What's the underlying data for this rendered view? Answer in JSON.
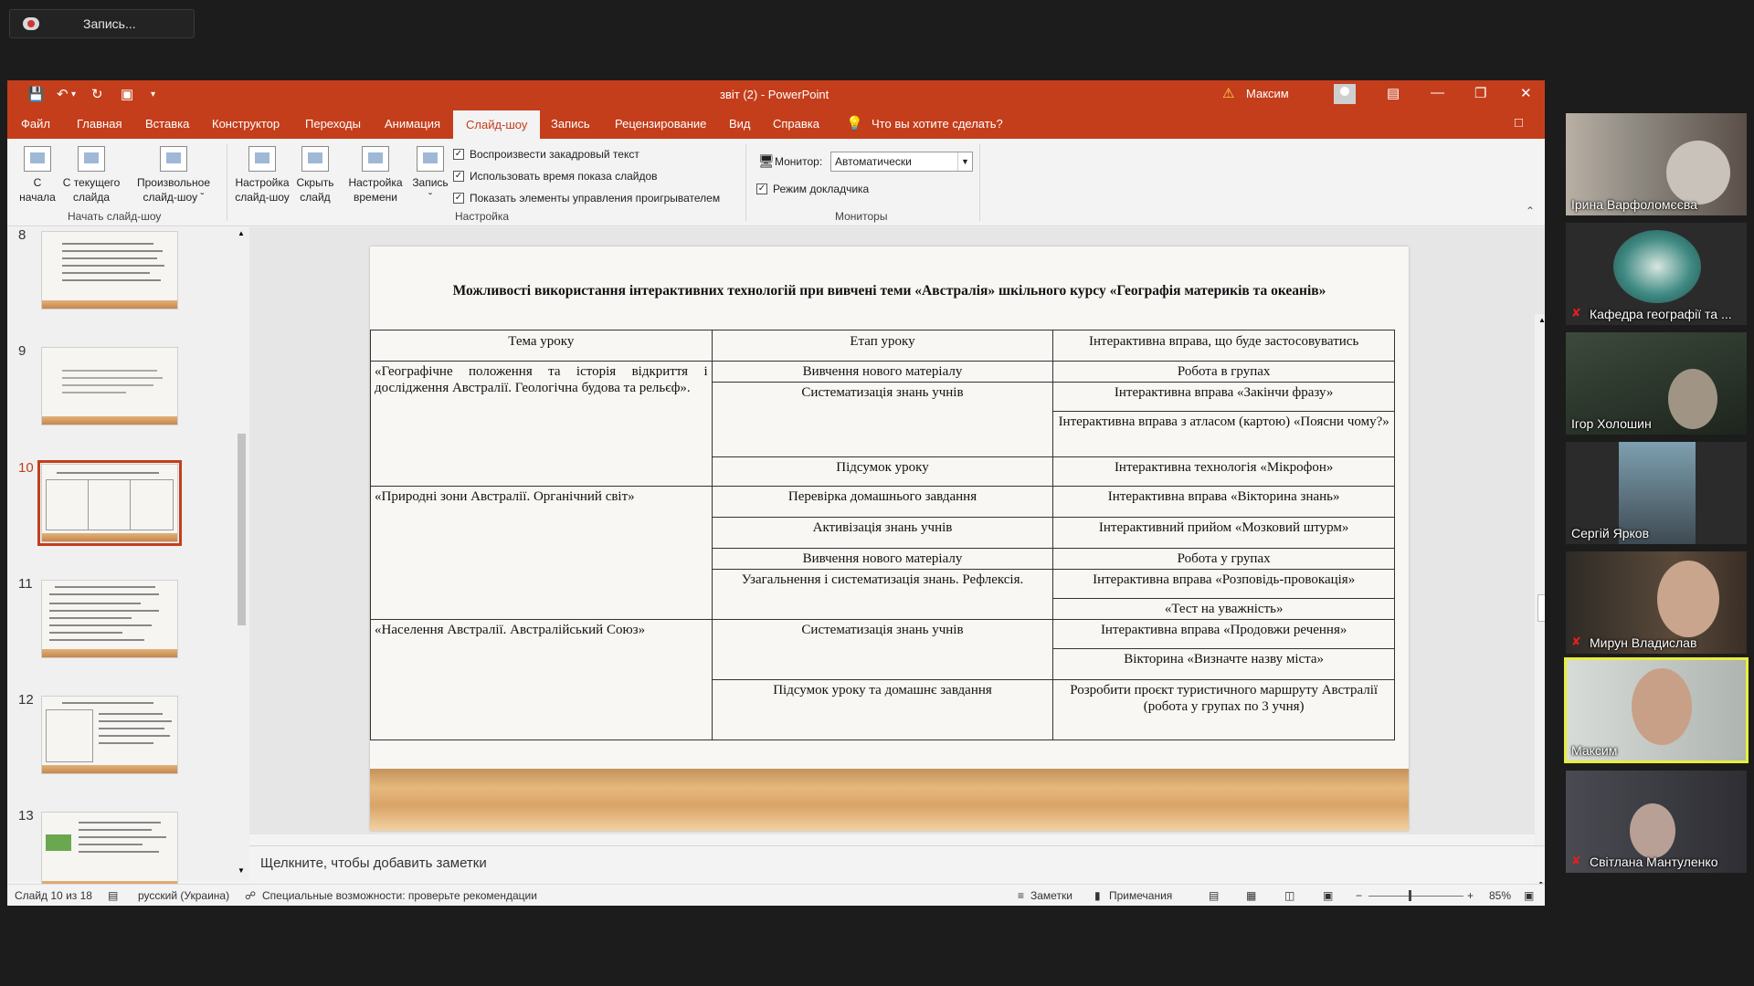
{
  "recording": {
    "label": "Запись..."
  },
  "window": {
    "title": "звіт (2)  -  PowerPoint",
    "user": "Максим"
  },
  "menu": {
    "tabs": [
      "Файл",
      "Главная",
      "Вставка",
      "Конструктор",
      "Переходы",
      "Анимация",
      "Слайд-шоу",
      "Запись",
      "Рецензирование",
      "Вид",
      "Справка"
    ],
    "active_tab": "Слайд-шоу",
    "search": "Что вы хотите сделать?"
  },
  "ribbon": {
    "from_start": "С начала",
    "from_current": [
      "С текущего",
      "слайда"
    ],
    "custom_show": [
      "Произвольное",
      "слайд-шоу"
    ],
    "group_start": "Начать слайд-шоу",
    "setup_show": [
      "Настройка",
      "слайд-шоу"
    ],
    "hide_slide": [
      "Скрыть",
      "слайд"
    ],
    "rehearse": [
      "Настройка",
      "времени"
    ],
    "record": "Запись",
    "check_narration": "Воспроизвести закадровый текст",
    "check_timings": "Использовать время показа слайдов",
    "check_media": "Показать элементы управления проигрывателем",
    "group_setup": "Настройка",
    "monitor_label": "Монитор:",
    "monitor_value": "Автоматически",
    "presenter_view": "Режим докладчика",
    "group_monitors": "Мониторы"
  },
  "thumbnails": {
    "numbers": [
      "8",
      "9",
      "10",
      "11",
      "12",
      "13"
    ],
    "active": "10"
  },
  "slide": {
    "title": "Можливості використання інтерактивних технологій при вивчені теми «Австралія» шкільного курсу «Географія материків та океанів»",
    "headers": [
      "Тема уроку",
      "Етап уроку",
      "Інтерактивна вправа, що буде застосовуватись"
    ],
    "topics": [
      "«Географічне положення та історія відкриття і дослідження Австралії. Геологічна будова та рельєф».",
      "«Природні зони Австралії. Органічний світ»",
      "«Населення Австралії. Австралійський Союз»"
    ],
    "stages": [
      "Вивчення нового матеріалу",
      "Систематизація знань учнів",
      "Підсумок уроку",
      "Перевірка домашнього завдання",
      "Активізація знань учнів",
      "Вивчення нового матеріалу",
      "Узагальнення і систематизація знань. Рефлексія.",
      "Систематизація знань учнів",
      "Підсумок уроку та домашнє завдання"
    ],
    "exercises": [
      "Робота в групах",
      "Інтерактивна вправа «Закінчи фразу»",
      "Інтерактивна вправа з атласом (картою) «Поясни чому?»",
      "Інтерактивна технологія «Мікрофон»",
      "Інтерактивна вправа «Вікторина знань»",
      "Інтерактивний прийом «Мозковий штурм»",
      "Робота у групах",
      "Інтерактивна вправа «Розповідь-провокація»",
      "«Тест на уважність»",
      "Інтерактивна вправа «Продовжи речення»",
      "Вікторина «Визначте назву міста»",
      "Розробити проєкт туристичного маршруту Австралії (робота у групах по 3 учня)"
    ]
  },
  "notes_placeholder": "Щелкните, чтобы добавить заметки",
  "status": {
    "slide": "Слайд 10 из 18",
    "lang": "русский (Украина)",
    "accessibility": "Специальные возможности: проверьте рекомендации",
    "notes": "Заметки",
    "comments": "Примечания",
    "zoom": "85%"
  },
  "participants": [
    {
      "name": "Ірина Варфоломєєва",
      "muted": false
    },
    {
      "name": "Кафедра географії та ...",
      "muted": true
    },
    {
      "name": "Ігор Холошин",
      "muted": false
    },
    {
      "name": "Сергій Ярков",
      "muted": false
    },
    {
      "name": "Мирун Владислав",
      "muted": true
    },
    {
      "name": "Максим",
      "muted": false
    },
    {
      "name": "Світлана Мантуленко",
      "muted": true
    }
  ],
  "colors": {
    "accent": "#c43e1c",
    "speaker_border": "#e8ef3a"
  }
}
